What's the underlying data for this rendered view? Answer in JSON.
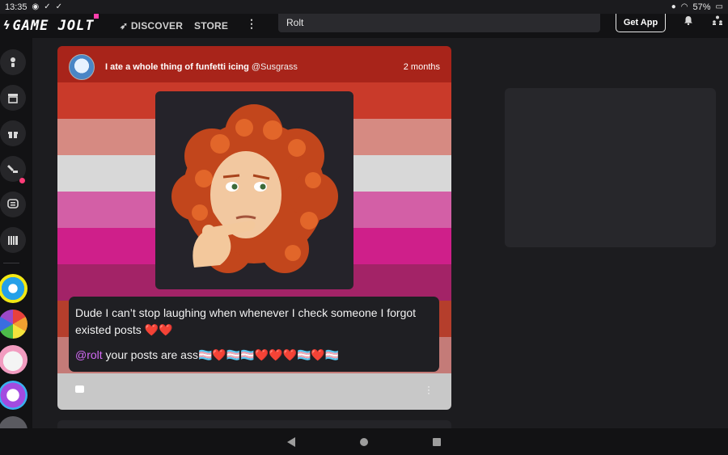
{
  "status_bar": {
    "time": "13:35",
    "battery": "57%",
    "left_icons": [
      "notification-circle-icon",
      "check-icon",
      "check-icon"
    ],
    "right_icons": [
      "app-notification-icon",
      "wifi-icon",
      "battery-icon"
    ]
  },
  "top_nav": {
    "logo_text": "GAME JOLT",
    "discover": "DISCOVER",
    "store": "STORE",
    "more": "⋮",
    "search_value": "Rolt",
    "get_app": "Get App"
  },
  "sidebar": {
    "items": [
      {
        "icon": "user-icon",
        "label": ""
      },
      {
        "icon": "store-icon",
        "label": ""
      },
      {
        "icon": "gift-icon",
        "label": ""
      },
      {
        "icon": "game-icon",
        "label": ""
      },
      {
        "icon": "chat-icon",
        "label": ""
      },
      {
        "icon": "library-icon",
        "label": ""
      }
    ],
    "communities": [
      "community-1",
      "community-2",
      "community-3",
      "community-4",
      "community-5"
    ]
  },
  "post": {
    "title": "I ate a whole thing of funfetti icing",
    "username": "@Susgrass",
    "time": "2 months",
    "text_line1": "Dude I can’t stop laughing when whenever I check someone I forgot existed posts ❤️❤️",
    "mention": "@rolt",
    "text_line2": " your posts are ass🏳️‍⚧️❤️🏳️‍⚧️🏳️‍⚧️❤️❤️❤️🏳️‍⚧️❤️🏳️‍⚧️"
  },
  "colors": {
    "background": "#1c1c1f",
    "nav_bg": "#121214",
    "mention": "#d36af5",
    "stripes": [
      "#a8241a",
      "#c93a2a",
      "#d68a82",
      "#d8d8d8",
      "#d35fa6",
      "#cf1f8a",
      "#a32367",
      "#b53e2c",
      "#c47b78",
      "#c8c8c8"
    ]
  }
}
